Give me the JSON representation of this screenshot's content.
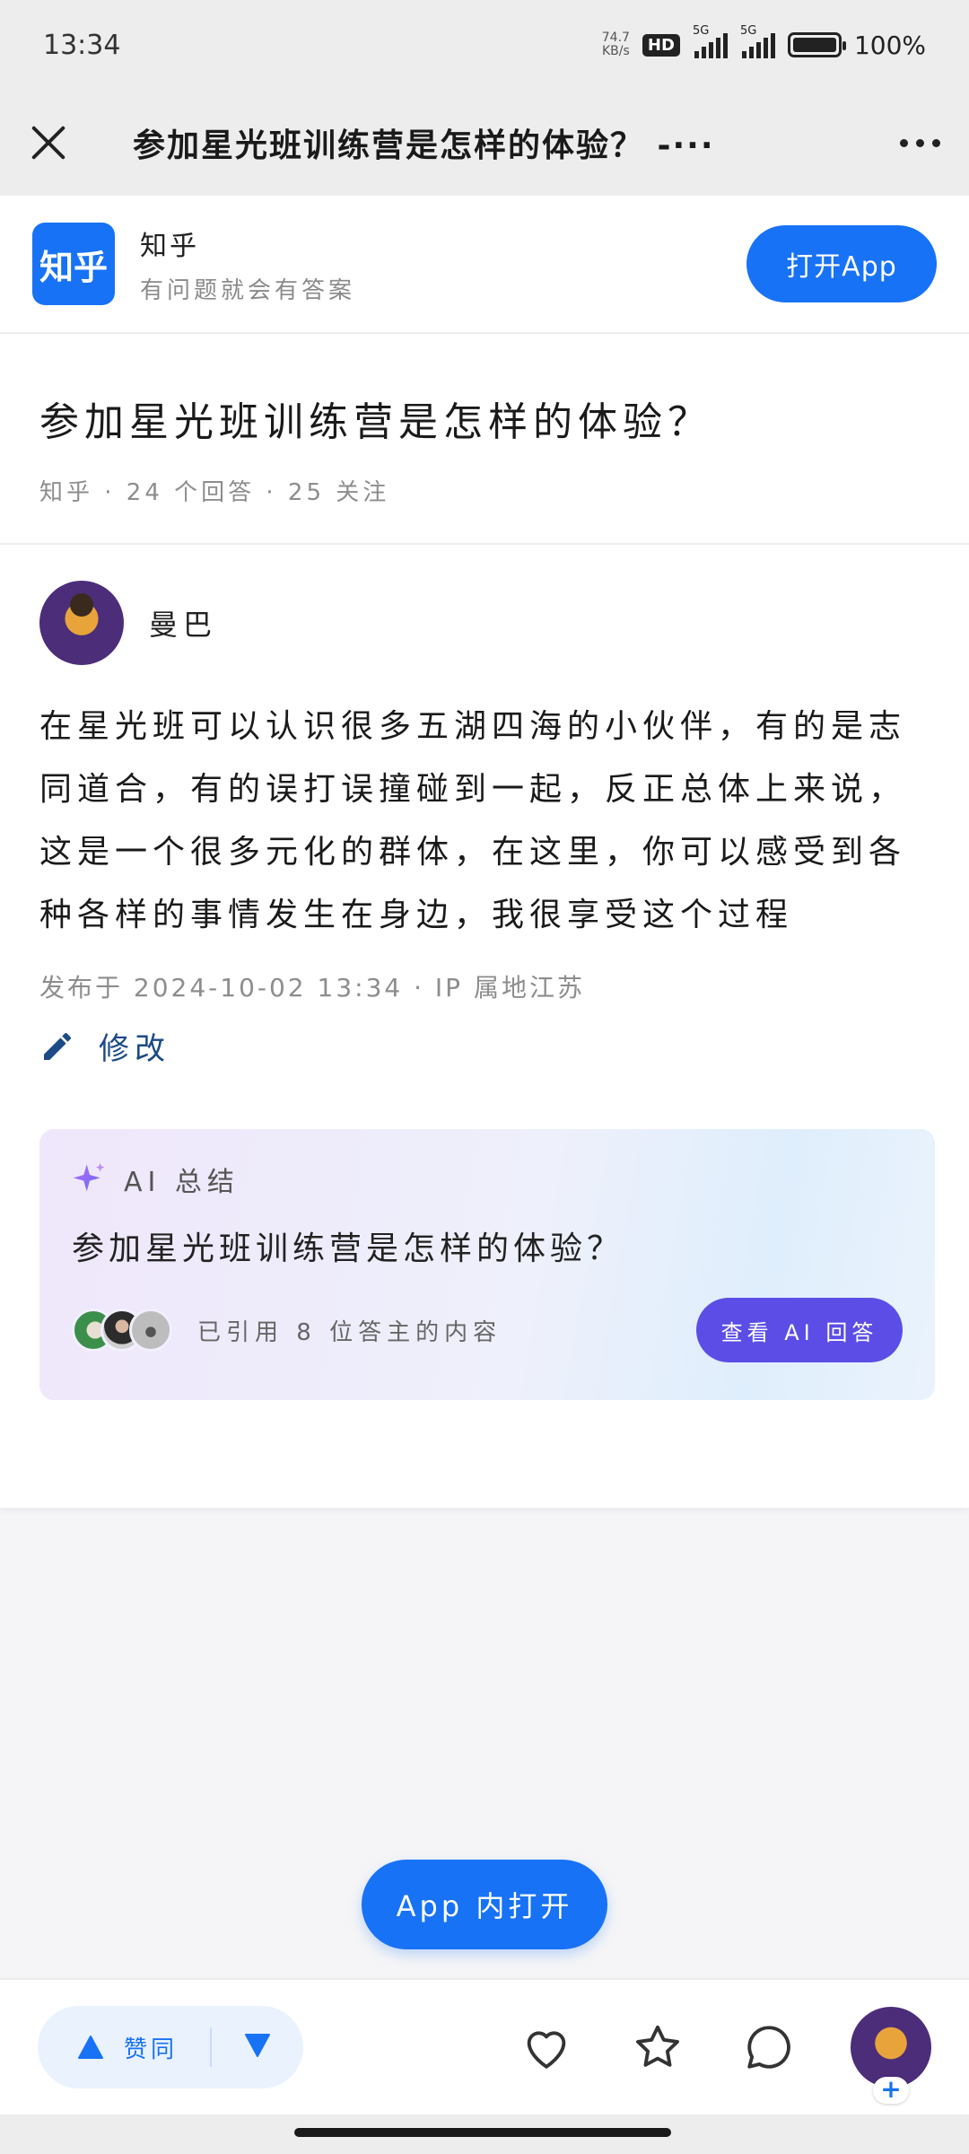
{
  "status_bar": {
    "time": "13:34",
    "net_speed_value": "74.7",
    "net_speed_unit": "KB/s",
    "hd_badge": "HD",
    "signal1_label": "5G",
    "signal2_label": "5G",
    "battery_percent": "100%"
  },
  "title_bar": {
    "title": "参加星光班训练营是怎样的体验？ -···"
  },
  "banner": {
    "logo_text": "知乎",
    "name": "知乎",
    "slogan": "有问题就会有答案",
    "open_app_label": "打开App"
  },
  "question": {
    "title": "参加星光班训练营是怎样的体验？",
    "meta": "知乎 · 24 个回答 · 25 关注"
  },
  "answer": {
    "author_name": "曼巴",
    "body": "在星光班可以认识很多五湖四海的小伙伴，有的是志同道合，有的误打误撞碰到一起，反正总体上来说，这是一个很多元化的群体，在这里，你可以感受到各种各样的事情发生在身边，我很享受这个过程",
    "publish_info": "发布于 2024-10-02 13:34 · IP 属地江苏",
    "edit_label": "修改"
  },
  "ai_summary": {
    "header": "AI 总结",
    "question": "参加星光班训练营是怎样的体验？",
    "citation": "已引用 8 位答主的内容",
    "button_label": "查看 AI 回答"
  },
  "float_button": {
    "label": "App 内打开"
  },
  "bottom_bar": {
    "vote_up_label": "赞同",
    "avatar_plus": "+"
  },
  "colors": {
    "brand_blue": "#1772f6",
    "ai_purple": "#5b4de6",
    "edit_blue": "#1b4a86"
  },
  "icons": [
    "close-icon",
    "more-icon",
    "pencil-icon",
    "sparkle-icon",
    "vote-up-icon",
    "vote-down-icon",
    "heart-icon",
    "star-icon",
    "comment-icon"
  ]
}
